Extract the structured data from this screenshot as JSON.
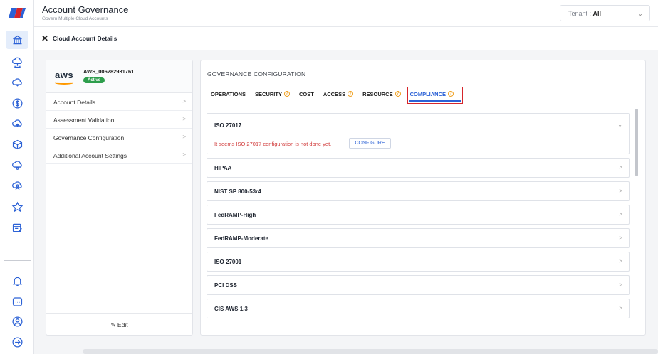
{
  "header": {
    "title": "Account Governance",
    "subtitle": "Govern Multiple Cloud Accounts",
    "tenant_label": "Tenant :",
    "tenant_value": "All"
  },
  "subheader": {
    "title": "Cloud Account Details"
  },
  "account": {
    "provider": "aws",
    "id": "AWS_006282931761",
    "status": "Active",
    "menu": [
      {
        "label": "Account Details"
      },
      {
        "label": "Assessment Validation"
      },
      {
        "label": "Governance Configuration"
      },
      {
        "label": "Additional Account Settings"
      }
    ],
    "edit_label": "Edit"
  },
  "governance": {
    "title": "GOVERNANCE CONFIGURATION",
    "tabs": [
      {
        "label": "OPERATIONS",
        "info": false
      },
      {
        "label": "SECURITY",
        "info": true
      },
      {
        "label": "COST",
        "info": false
      },
      {
        "label": "ACCESS",
        "info": true
      },
      {
        "label": "RESOURCE",
        "info": true
      },
      {
        "label": "COMPLIANCE",
        "info": true,
        "active": true
      }
    ],
    "standards": [
      {
        "name": "ISO 27017",
        "expanded": true
      },
      {
        "name": "HIPAA"
      },
      {
        "name": "NIST SP 800-53r4"
      },
      {
        "name": "FedRAMP-High"
      },
      {
        "name": "FedRAMP-Moderate"
      },
      {
        "name": "ISO 27001"
      },
      {
        "name": "PCI DSS"
      },
      {
        "name": "CIS AWS 1.3"
      }
    ],
    "warning": "It seems ISO 27017 configuration is not done yet.",
    "configure_label": "CONFIGURE"
  },
  "colors": {
    "accent": "#2b61d6",
    "active_badge": "#2e9e4c",
    "warning": "#d13b3b",
    "highlight_box": "#d6262b",
    "info_icon": "#f0a020"
  }
}
